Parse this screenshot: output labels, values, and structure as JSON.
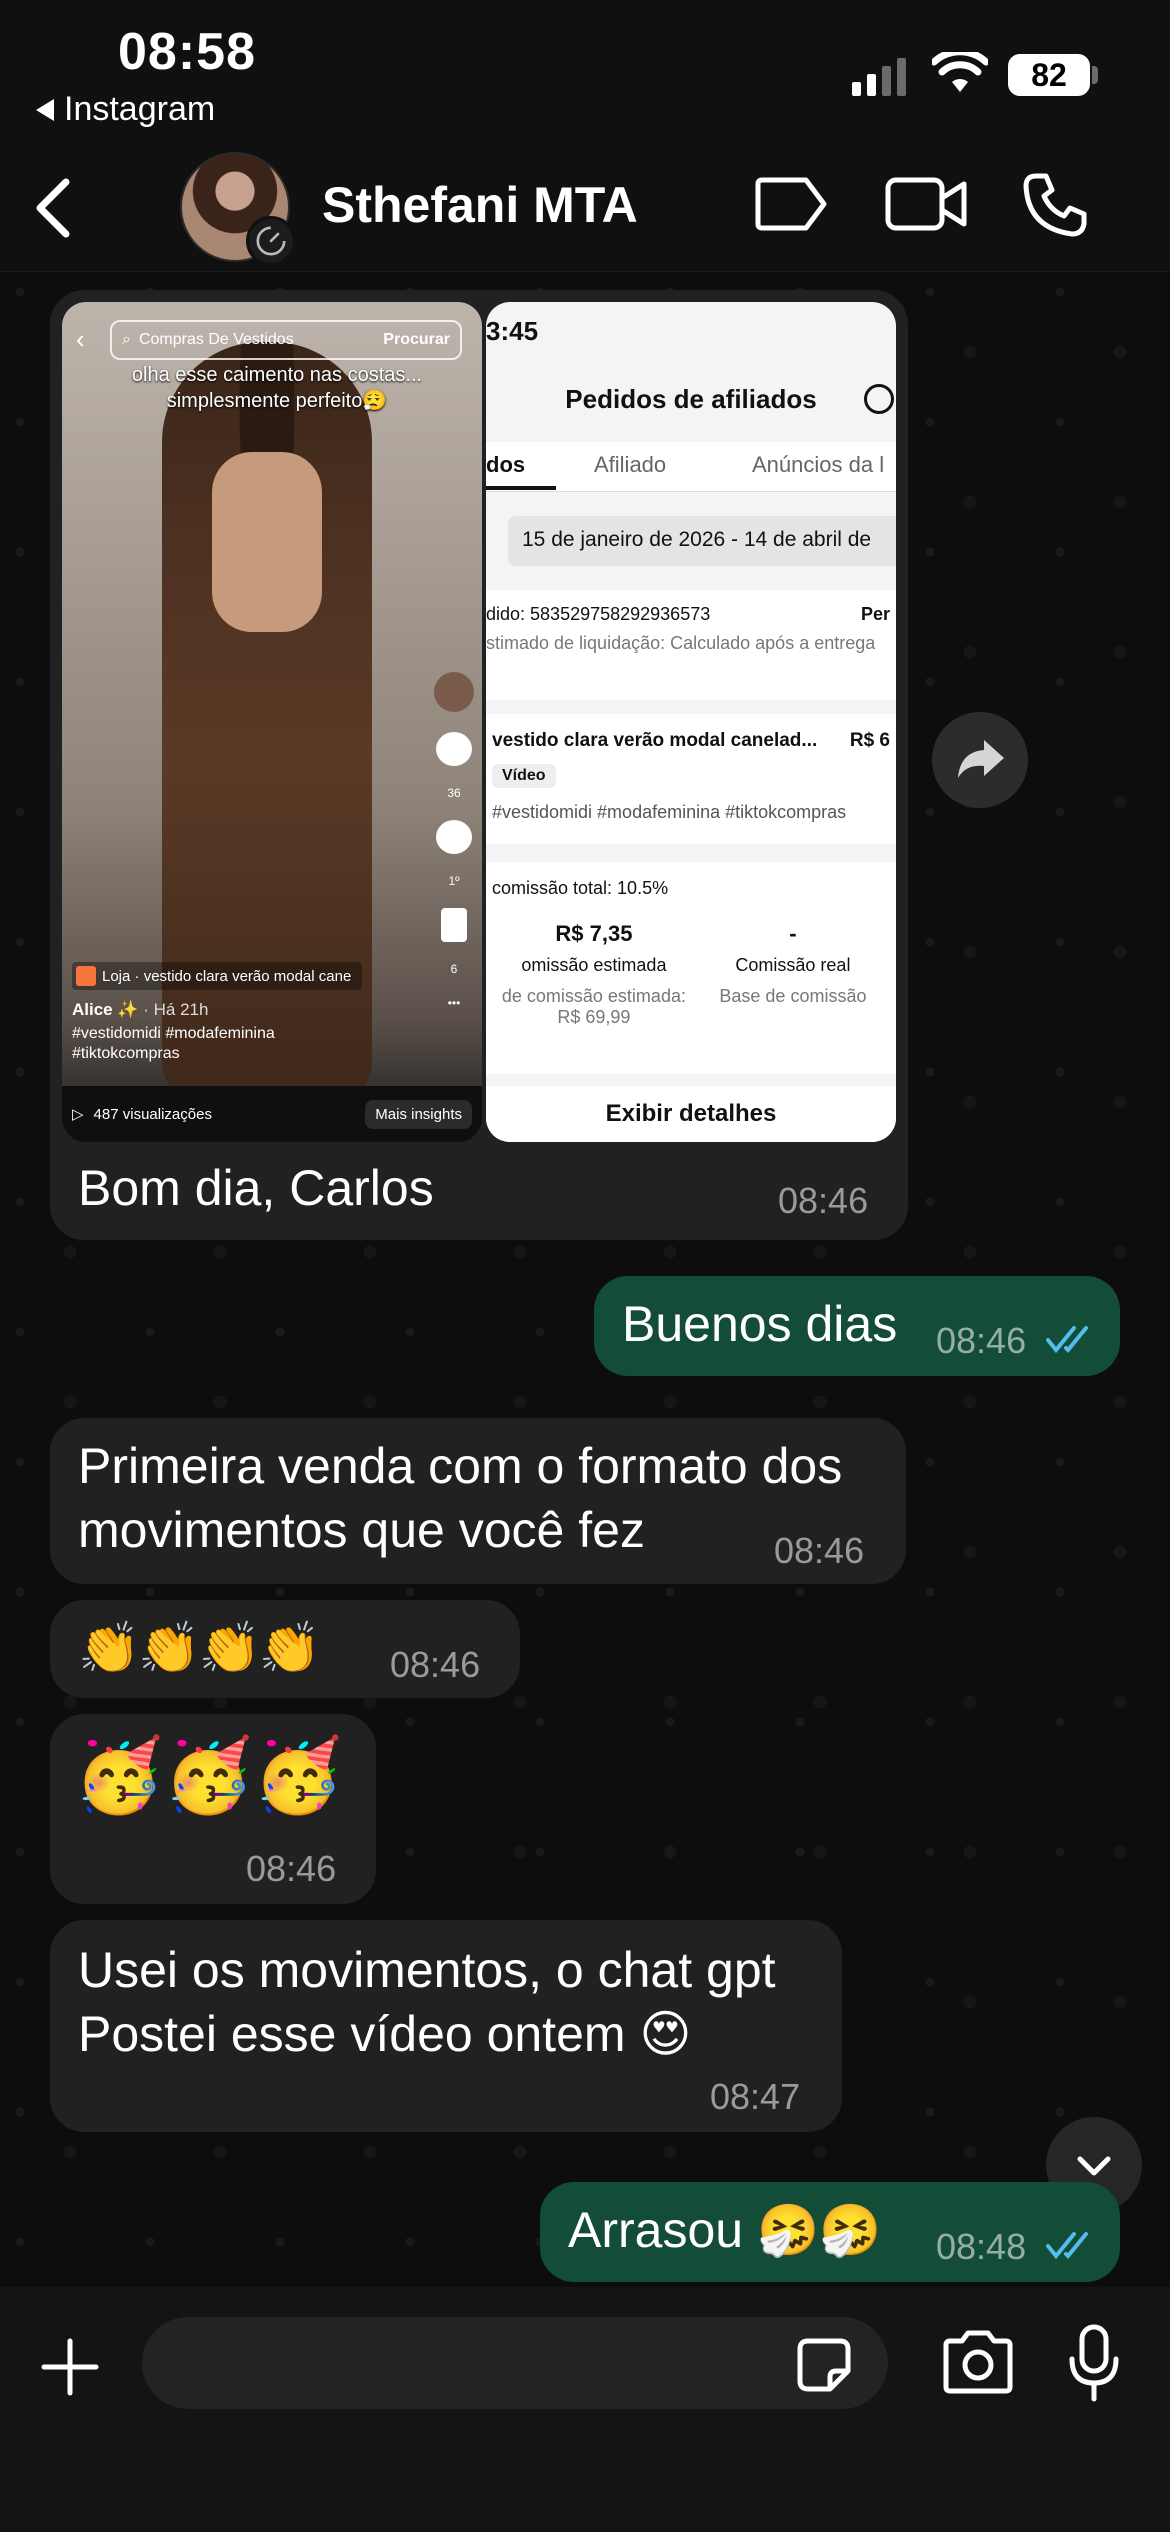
{
  "status_bar": {
    "time": "08:58",
    "back_app": "Instagram",
    "battery": "82"
  },
  "header": {
    "contact_name": "Sthefani MTA"
  },
  "image_message": {
    "tiktok": {
      "search_text": "Compras De Vestidos",
      "search_button": "Procurar",
      "caption": "olha esse caimento nas costas... simplesmente perfeito😮‍💨",
      "likes": "36",
      "comments": "1º",
      "saves": "6",
      "shop_label": "Loja · vestido clara verão modal cane",
      "user": "Alice ✨",
      "time_ago": "· Há 21h",
      "hashtags": "#vestidomidi #modafeminina #tiktokcompras",
      "views": "487 visualizações",
      "insights": "Mais insights"
    },
    "orders": {
      "time": "3:45",
      "title": "Pedidos de afiliados",
      "tabs": [
        "dos",
        "Afiliado",
        "Anúncios da l"
      ],
      "date_range": "15 de janeiro de 2026 - 14 de abril de",
      "order_id": "dido: 583529758292936573",
      "order_status": "Per",
      "settlement": "stimado de liquidação: Calculado após a entrega",
      "product_name": "vestido clara verão modal canelad...",
      "product_price": "R$ 6",
      "product_badge": "Vídeo",
      "product_tags": "#vestidomidi #modafeminina #tiktokcompras",
      "commission_rate": "comissão total: 10.5%",
      "est_commission_value": "R$ 7,35",
      "est_commission_label": "omissão estimada",
      "real_commission_value": "-",
      "real_commission_label": "Comissão real",
      "base_est_label": "de comissão estimada:",
      "base_est_value": "R$ 69,99",
      "base_real_label": "Base de comissão",
      "details_button": "Exibir detalhes"
    },
    "text": "Bom dia, Carlos",
    "time": "08:46"
  },
  "messages": [
    {
      "id": "m1",
      "text": "Buenos dias",
      "time": "08:46"
    },
    {
      "id": "m2",
      "text": "Primeira venda com o formato dos movimentos que você fez",
      "time": "08:46"
    },
    {
      "id": "m3",
      "text": "👏👏👏👏",
      "time": "08:46"
    },
    {
      "id": "m4",
      "text": "🥳🥳🥳",
      "time": "08:46"
    },
    {
      "id": "m5",
      "line1": "Usei os movimentos, o chat gpt",
      "line2": "Postei esse vídeo ontem 😍",
      "time": "08:47"
    },
    {
      "id": "m6",
      "text": "Arrasou 🤧🤧",
      "time": "08:48"
    }
  ],
  "colors": {
    "incoming": "#212121",
    "outgoing": "#144d37",
    "read_ticks": "#53bdeb"
  }
}
